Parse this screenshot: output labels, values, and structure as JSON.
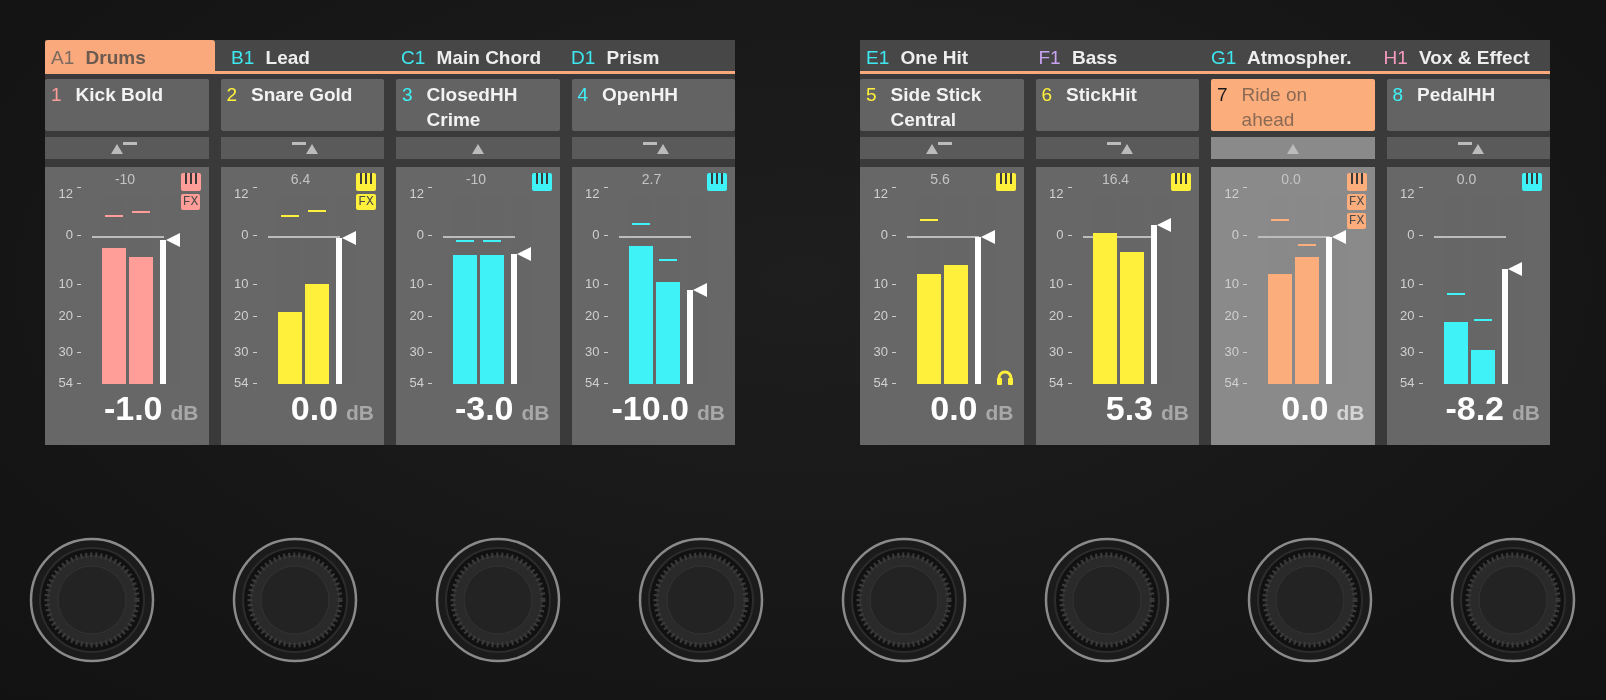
{
  "screens": [
    {
      "groups": [
        {
          "code": "A1",
          "name": "Drums",
          "color": "#7a6a60",
          "selected": true
        },
        {
          "code": "B1",
          "name": "Lead",
          "color": "#3ee8f0",
          "selected": false
        },
        {
          "code": "C1",
          "name": "Main Chord",
          "color": "#3ee8f0",
          "selected": false
        },
        {
          "code": "D1",
          "name": "Prism",
          "color": "#3ee8f0",
          "selected": false
        }
      ],
      "channels": [
        {
          "number": "1",
          "name": "Kick Bold",
          "color": "#ff9d98",
          "selected": false,
          "pan": {
            "kind": "left"
          },
          "peak": "-10",
          "badges": [
            "FX"
          ],
          "scale": [
            "12",
            "0",
            "10",
            "20",
            "30",
            "54"
          ],
          "meters": [
            {
              "level": 0.72,
              "hold": {
                "level": 0.84
              }
            },
            {
              "level": 0.67,
              "hold": {
                "level": 0.86
              }
            }
          ],
          "fader": {
            "level": 0.76
          },
          "value": "-1.0",
          "unit": "dB"
        },
        {
          "number": "2",
          "name": "Snare Gold",
          "color": "#fff03c",
          "selected": false,
          "pan": {
            "kind": "right"
          },
          "peak": "6.4",
          "badges": [
            "FX"
          ],
          "scale": [
            "12",
            "0",
            "10",
            "20",
            "30",
            "54"
          ],
          "meters": [
            {
              "level": 0.38,
              "hold": {
                "level": 0.84
              }
            },
            {
              "level": 0.53,
              "hold": {
                "level": 0.87
              }
            }
          ],
          "fader": {
            "level": 0.77
          },
          "value": "0.0",
          "unit": "dB"
        },
        {
          "number": "3",
          "name": "ClosedHH Crime",
          "color": "#3ef2f7",
          "selected": false,
          "pan": {
            "kind": "center"
          },
          "peak": "-10",
          "scale": [
            "12",
            "0",
            "10",
            "20",
            "30",
            "54"
          ],
          "meters": [
            {
              "level": 0.68,
              "hold": {
                "level": 0.71
              }
            },
            {
              "level": 0.68,
              "hold": {
                "level": 0.71
              }
            }
          ],
          "fader": {
            "level": 0.69
          },
          "value": "-3.0",
          "unit": "dB"
        },
        {
          "number": "4",
          "name": "OpenHH",
          "color": "#3ef2f7",
          "selected": false,
          "pan": {
            "kind": "right"
          },
          "peak": "2.7",
          "scale": [
            "12",
            "0",
            "10",
            "20",
            "30",
            "54"
          ],
          "meters": [
            {
              "level": 0.73,
              "hold": {
                "level": 0.8
              }
            },
            {
              "level": 0.54,
              "hold": {
                "level": 0.61
              }
            }
          ],
          "fader": {
            "level": 0.5
          },
          "value": "-10.0",
          "unit": "dB"
        }
      ]
    },
    {
      "groups": [
        {
          "code": "E1",
          "name": "One Hit",
          "color": "#3ee8f0",
          "selected": false
        },
        {
          "code": "F1",
          "name": "Bass",
          "color": "#c9a2f2",
          "selected": false
        },
        {
          "code": "G1",
          "name": "Atmospher.",
          "color": "#3ee8f0",
          "selected": false
        },
        {
          "code": "H1",
          "name": "Vox & Effect",
          "color": "#f59ac0",
          "selected": false
        }
      ],
      "channels": [
        {
          "number": "5",
          "name": "Side Stick Central",
          "color": "#fff03c",
          "selected": false,
          "pan": {
            "kind": "left"
          },
          "peak": "5.6",
          "cue": true,
          "scale": [
            "12",
            "0",
            "10",
            "20",
            "30",
            "54"
          ],
          "meters": [
            {
              "level": 0.58,
              "hold": {
                "level": 0.82
              }
            },
            {
              "level": 0.63
            }
          ],
          "fader": {
            "level": 0.78
          },
          "value": "0.0",
          "unit": "dB"
        },
        {
          "number": "6",
          "name": "StickHit",
          "color": "#fff03c",
          "selected": false,
          "pan": {
            "kind": "right"
          },
          "peak": "16.4",
          "scale": [
            "12",
            "0",
            "10",
            "20",
            "30",
            "54"
          ],
          "meters": [
            {
              "level": 0.8
            },
            {
              "level": 0.7
            }
          ],
          "fader": {
            "level": 0.84
          },
          "value": "5.3",
          "unit": "dB"
        },
        {
          "number": "7",
          "name": "Ride on ahead",
          "color": "#fcad7c",
          "selected": true,
          "pan": {
            "kind": "center"
          },
          "peak": "0.0",
          "badges": [
            "FX",
            "FX"
          ],
          "scale": [
            "12",
            "0",
            "10",
            "20",
            "30",
            "54"
          ],
          "meters": [
            {
              "level": 0.58,
              "hold": {
                "level": 0.82
              }
            },
            {
              "level": 0.67,
              "hold": {
                "level": 0.69
              }
            }
          ],
          "fader": {
            "level": 0.78
          },
          "value": "0.0",
          "unit": "dB"
        },
        {
          "number": "8",
          "name": "PedalHH",
          "color": "#3ef2f7",
          "selected": false,
          "pan": {
            "kind": "right"
          },
          "peak": "0.0",
          "scale": [
            "12",
            "0",
            "10",
            "20",
            "30",
            "54"
          ],
          "meters": [
            {
              "level": 0.33,
              "hold": {
                "level": 0.43
              }
            },
            {
              "level": 0.18,
              "hold": {
                "level": 0.29
              }
            }
          ],
          "fader": {
            "level": 0.61
          },
          "value": "-8.2",
          "unit": "dB"
        }
      ]
    }
  ]
}
